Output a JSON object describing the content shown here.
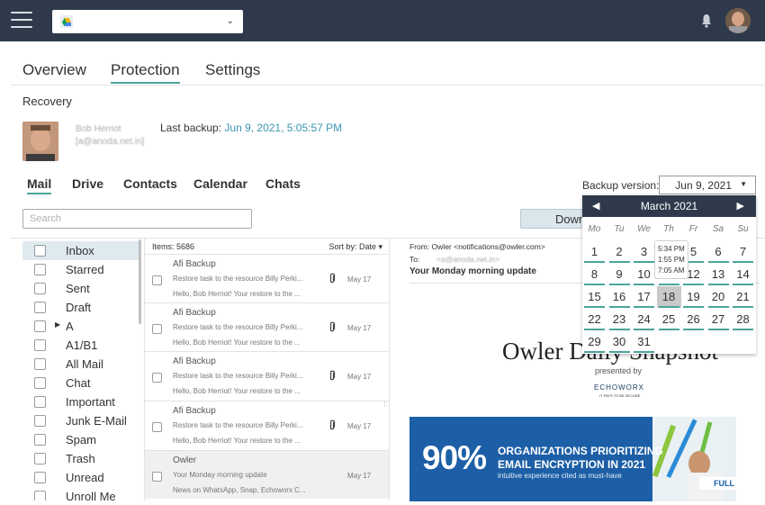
{
  "header": {
    "tenant_select_value": "",
    "icons": [
      "menu-icon",
      "google-drive-icon",
      "chevron-down-icon",
      "bell-icon",
      "user-avatar"
    ]
  },
  "main_tabs": [
    {
      "label": "Overview",
      "active": false
    },
    {
      "label": "Protection",
      "active": true
    },
    {
      "label": "Settings",
      "active": false
    }
  ],
  "recovery": {
    "title": "Recovery",
    "user_name": "Bob Herriot",
    "user_email": "[a@anoda.net.in]",
    "last_backup_label": "Last backup:",
    "last_backup_value": "Jun 9, 2021, 5:05:57 PM"
  },
  "sub_tabs": [
    {
      "label": "Mail",
      "active": true
    },
    {
      "label": "Drive",
      "active": false
    },
    {
      "label": "Contacts",
      "active": false
    },
    {
      "label": "Calendar",
      "active": false
    },
    {
      "label": "Chats",
      "active": false
    }
  ],
  "backup_version": {
    "label": "Backup version:",
    "value": "Jun 9, 2021"
  },
  "search": {
    "placeholder": "Search"
  },
  "download_button": {
    "label": "Down"
  },
  "folders": [
    {
      "label": "Inbox",
      "selected": true,
      "expandable": false
    },
    {
      "label": "Starred",
      "selected": false,
      "expandable": false
    },
    {
      "label": "Sent",
      "selected": false,
      "expandable": false
    },
    {
      "label": "Draft",
      "selected": false,
      "expandable": false
    },
    {
      "label": "A",
      "selected": false,
      "expandable": true
    },
    {
      "label": "A1/B1",
      "selected": false,
      "expandable": false
    },
    {
      "label": "All Mail",
      "selected": false,
      "expandable": false
    },
    {
      "label": "Chat",
      "selected": false,
      "expandable": false
    },
    {
      "label": "Important",
      "selected": false,
      "expandable": false
    },
    {
      "label": "Junk E-Mail",
      "selected": false,
      "expandable": false
    },
    {
      "label": "Spam",
      "selected": false,
      "expandable": false
    },
    {
      "label": "Trash",
      "selected": false,
      "expandable": false
    },
    {
      "label": "Unread",
      "selected": false,
      "expandable": false
    },
    {
      "label": "Unroll Me",
      "selected": false,
      "expandable": false
    }
  ],
  "message_list": {
    "count_label": "Items: 5686",
    "sort_label": "Sort by: Date ▾",
    "messages": [
      {
        "sender": "Afi Backup",
        "subject": "Restore task to the resource Billy Perki...",
        "preview": "Hello, Bob Herriot! Your restore to the ...",
        "date": "May 17",
        "attachment": true,
        "selected": false
      },
      {
        "sender": "Afi Backup",
        "subject": "Restore task to the resource Billy Perki...",
        "preview": "Hello, Bob Herriot! Your restore to the ...",
        "date": "May 17",
        "attachment": true,
        "selected": false
      },
      {
        "sender": "Afi Backup",
        "subject": "Restore task to the resource Billy Perki...",
        "preview": "Hello, Bob Herriot! Your restore to the ...",
        "date": "May 17",
        "attachment": true,
        "selected": false
      },
      {
        "sender": "Afi Backup",
        "subject": "Restore task to the resource Billy Perki...",
        "preview": "Hello, Bob Herriot! Your restore to the ...",
        "date": "May 17",
        "attachment": true,
        "selected": false
      },
      {
        "sender": "Owler",
        "subject": "Your Monday morning update",
        "preview": "News on WhatsApp, Snap, Echoworx C...",
        "date": "May 17",
        "attachment": false,
        "selected": true
      }
    ]
  },
  "reader": {
    "from": "From: Owler <notifications@owler.com>",
    "to_label": "To:",
    "to_value": "<a@anoda.net.in>",
    "subject": "Your Monday morning update",
    "newsletter_title": "Owler Daily Snapshot",
    "presented_by": "presented by",
    "sponsor": "ECHOWORX",
    "sponsor_tagline": "IT PAYS TO BE SECURE",
    "banner": {
      "percent": "90%",
      "line1": "ORGANIZATIONS PRIORITIZING",
      "line2": "EMAIL ENCRYPTION IN 2021",
      "line3": "intuitive experience cited as must-have",
      "cta": "FULL"
    }
  },
  "calendar": {
    "month_label": "March 2021",
    "weekdays": [
      "Mo",
      "Tu",
      "We",
      "Th",
      "Fr",
      "Sa",
      "Su"
    ],
    "weeks": [
      [
        "1",
        "2",
        "3",
        "4",
        "5",
        "6",
        "7"
      ],
      [
        "8",
        "9",
        "10",
        "11",
        "12",
        "13",
        "14"
      ],
      [
        "15",
        "16",
        "17",
        "18",
        "19",
        "20",
        "21"
      ],
      [
        "22",
        "23",
        "24",
        "25",
        "26",
        "27",
        "28"
      ],
      [
        "29",
        "30",
        "31",
        "",
        "",
        "",
        ""
      ]
    ],
    "selected_day": "18",
    "tooltip_times": [
      "5:34 PM",
      "1:55 PM",
      "7:05 AM"
    ]
  },
  "colors": {
    "topbar": "#2e3a4b",
    "accent": "#4aa59a",
    "link": "#3a95b0",
    "banner": "#1d5fa6"
  }
}
